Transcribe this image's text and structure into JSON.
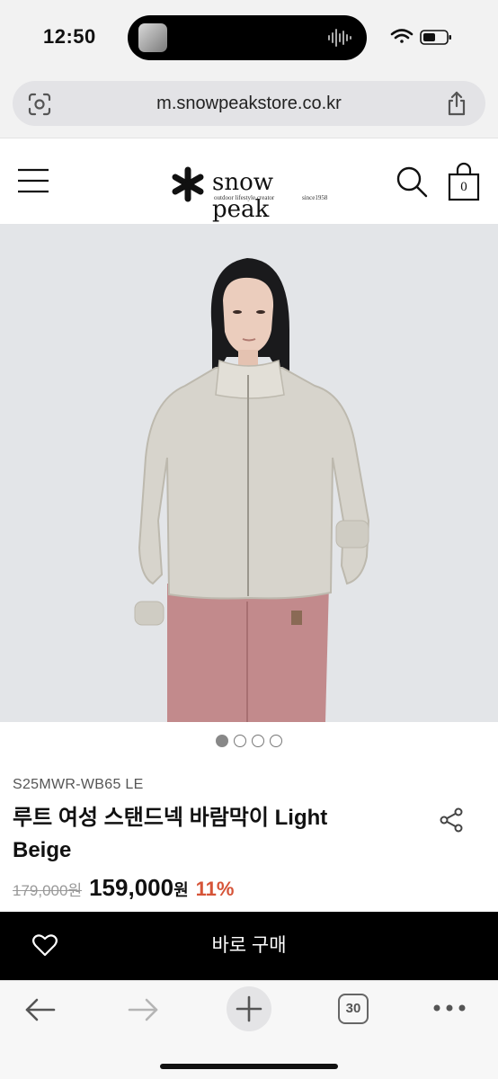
{
  "status_bar": {
    "time": "12:50"
  },
  "browser": {
    "url": "m.snowpeakstore.co.kr",
    "tab_count": "30"
  },
  "header": {
    "logo_name": "snow peak",
    "logo_tagline": "outdoor lifestyle creator",
    "logo_since": "since1958",
    "cart_count": "0"
  },
  "carousel": {
    "total": 4,
    "active_index": 0
  },
  "product": {
    "code": "S25MWR-WB65 LE",
    "name": "루트 여성 스탠드넥 바람막이 Light Beige",
    "original_price": "179,000원",
    "sale_price": "159,000",
    "sale_currency": "원",
    "discount": "11%"
  },
  "actions": {
    "buy_now": "바로 구매"
  },
  "colors": {
    "discount": "#d65438",
    "buy_bar": "#000000",
    "image_bg": "#e3e5e8"
  }
}
